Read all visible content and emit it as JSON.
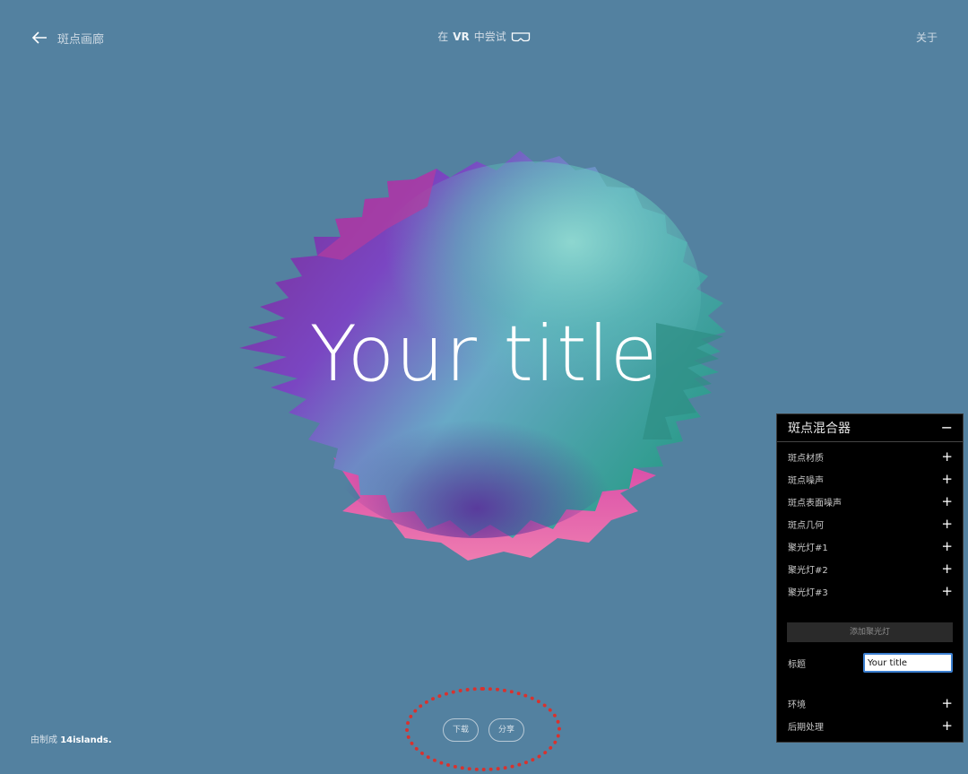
{
  "header": {
    "back_label": "斑点画廊",
    "vr_prefix": "在 ",
    "vr_bold": "VR",
    "vr_suffix": " 中尝试",
    "about_label": "关于"
  },
  "blob": {
    "title": "Your title"
  },
  "footer": {
    "credit_prefix": "由制成 ",
    "credit_brand": "14islands."
  },
  "actions": {
    "download_label": "下载",
    "share_label": "分享"
  },
  "panel": {
    "title": "斑点混合器",
    "collapse_icon": "minus-icon",
    "folders_top": [
      {
        "label": "斑点材质"
      },
      {
        "label": "斑点噪声"
      },
      {
        "label": "斑点表面噪声"
      },
      {
        "label": "斑点几何"
      },
      {
        "label": "聚光灯#1"
      },
      {
        "label": "聚光灯#2"
      },
      {
        "label": "聚光灯#3"
      }
    ],
    "add_light_label": "添加聚光灯",
    "title_field_label": "标题",
    "title_field_value": "Your title",
    "folders_bottom": [
      {
        "label": "环境"
      },
      {
        "label": "后期处理"
      }
    ]
  },
  "colors": {
    "background": "#5381a0",
    "highlight_ring": "#d8322e",
    "blob_magenta": "#c23e9c",
    "blob_purple": "#6f3fb6",
    "blob_teal": "#3fb7a8",
    "blob_pink": "#e2609f"
  }
}
